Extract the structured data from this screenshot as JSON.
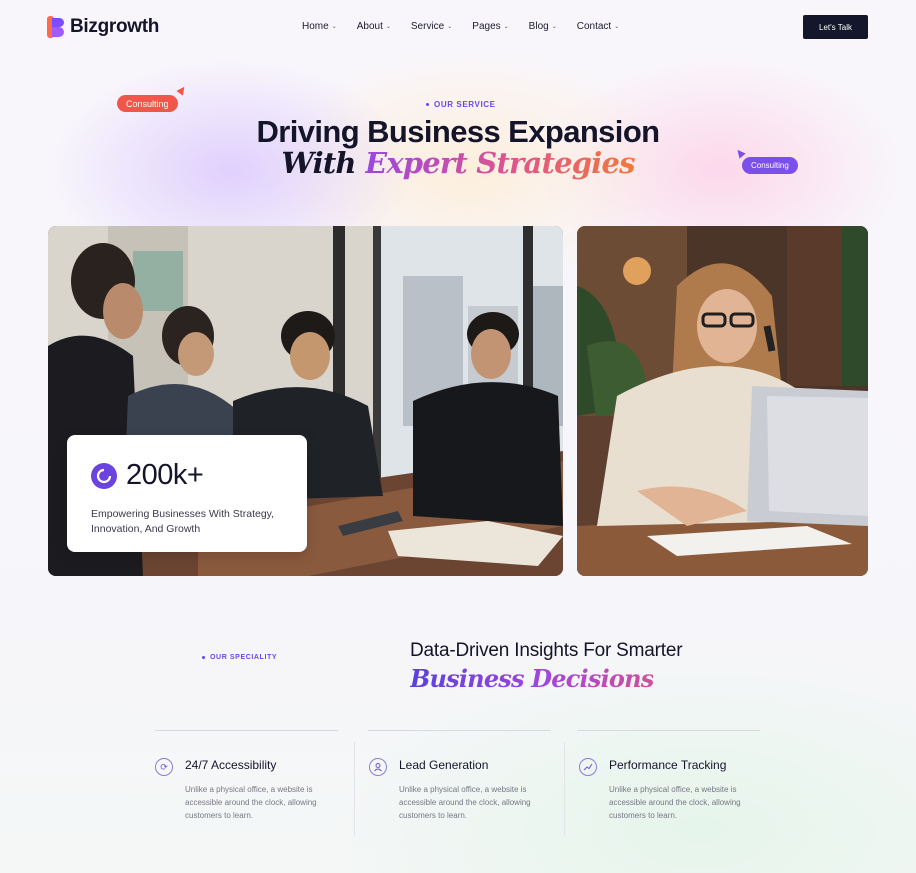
{
  "brand": {
    "name": "Bizgrowth"
  },
  "nav": {
    "items": [
      {
        "label": "Home"
      },
      {
        "label": "About"
      },
      {
        "label": "Service"
      },
      {
        "label": "Pages"
      },
      {
        "label": "Blog"
      },
      {
        "label": "Contact"
      }
    ],
    "chevron": "⌄",
    "cta_label": "Let's Talk"
  },
  "hero": {
    "eyebrow": "OUR SERVICE",
    "title_line1": "Driving Business Expansion",
    "title_line2_plain": "With",
    "title_line2_accent": "Expert Strategies",
    "tag_left": "Consulting",
    "tag_right": "Consulting"
  },
  "stat": {
    "value": "200k+",
    "description": "Empowering Businesses With Strategy, Innovation, And Growth"
  },
  "speciality": {
    "eyebrow": "OUR SPECIALITY",
    "title_line1": "Data-Driven Insights For Smarter",
    "title_line2": "Business Decisions"
  },
  "features": [
    {
      "icon": "refresh-icon",
      "title": "24/7 Accessibility",
      "description": "Unlike a physical office, a website is accessible around the clock, allowing customers to learn."
    },
    {
      "icon": "user-icon",
      "title": "Lead Generation",
      "description": "Unlike a physical office, a website is accessible around the clock, allowing customers to learn."
    },
    {
      "icon": "chart-icon",
      "title": "Performance Tracking",
      "description": "Unlike a physical office, a website is accessible around the clock, allowing customers to learn."
    }
  ],
  "colors": {
    "accent": "#6b43dd",
    "brand_orange": "#f0574a",
    "dark": "#14162b"
  }
}
